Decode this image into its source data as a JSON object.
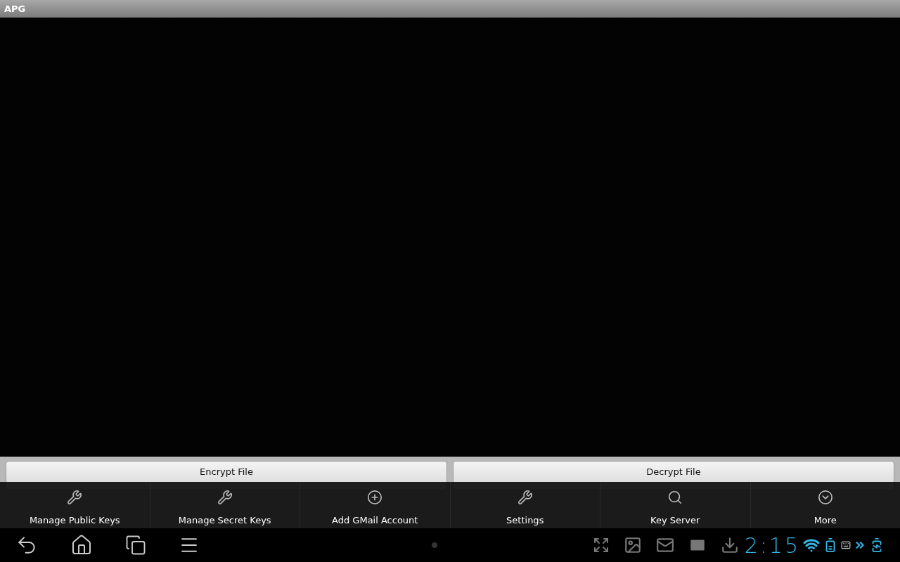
{
  "app_bar": {
    "title": "APG"
  },
  "buttons": [
    {
      "label": "Encrypt File"
    },
    {
      "label": "Decrypt File"
    }
  ],
  "options_menu": [
    {
      "label": "Manage Public Keys"
    },
    {
      "label": "Manage Secret Keys"
    },
    {
      "label": "Add GMail Account"
    },
    {
      "label": "Settings"
    },
    {
      "label": "Key Server"
    },
    {
      "label": "More"
    }
  ],
  "system_bar": {
    "clock": "2:15"
  }
}
